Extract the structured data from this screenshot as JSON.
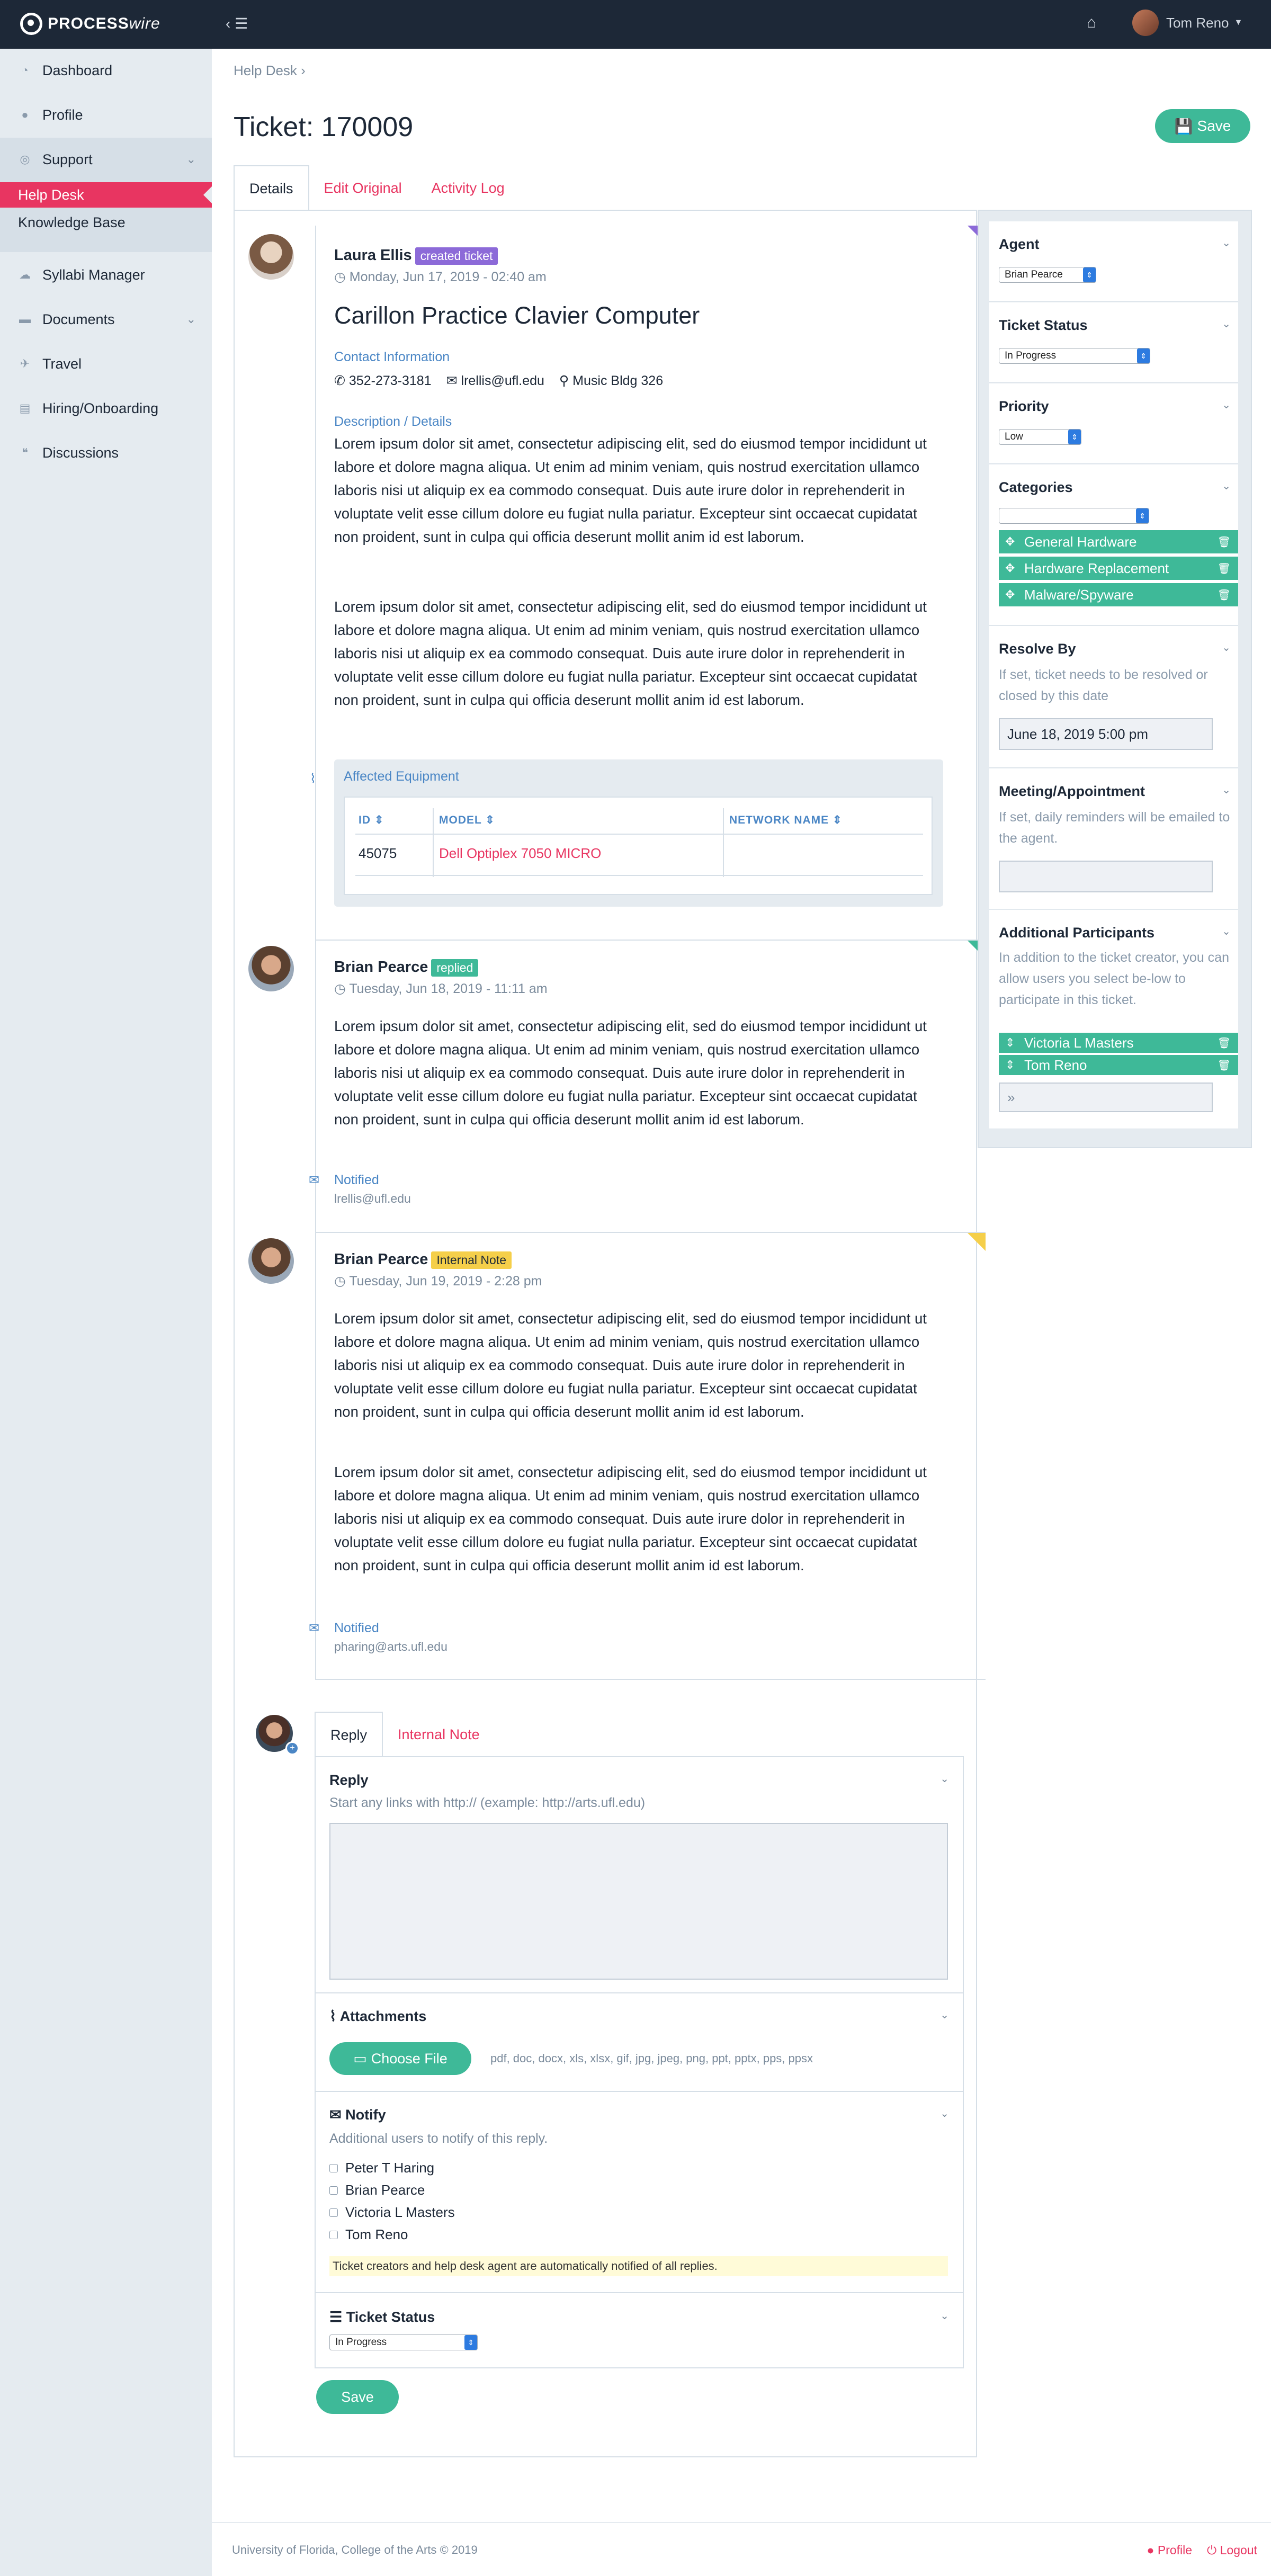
{
  "app": {
    "logo_main": "PROCESS",
    "logo_italic": "wire",
    "user_name": "Tom Reno"
  },
  "colors": {
    "accent": "#e83561",
    "green": "#3eb998",
    "navy": "#1d2837",
    "purple": "#8c6ad8",
    "yellow": "#f5cf4a"
  },
  "sidebar": {
    "items": [
      {
        "label": "Dashboard",
        "icon": "dashboard-icon"
      },
      {
        "label": "Profile",
        "icon": "user-icon"
      },
      {
        "label": "Support",
        "icon": "life-ring-icon"
      },
      {
        "label": "Syllabi Manager",
        "icon": "cloud-icon"
      },
      {
        "label": "Documents",
        "icon": "folder-icon"
      },
      {
        "label": "Travel",
        "icon": "plane-icon"
      },
      {
        "label": "Hiring/Onboarding",
        "icon": "book-icon"
      },
      {
        "label": "Discussions",
        "icon": "comments-icon"
      }
    ],
    "sub": [
      "Help Desk",
      "Knowledge Base"
    ]
  },
  "breadcrumb": "Help Desk",
  "page": {
    "title": "Ticket: 170009",
    "save": "Save"
  },
  "tabs": [
    "Details",
    "Edit Original",
    "Activity Log"
  ],
  "ticket": {
    "author": "Laura Ellis",
    "badge": "created ticket",
    "date": "Monday, Jun 17, 2019 - 02:40 am",
    "subject": "Carillon Practice Clavier Computer",
    "contact_label": "Contact Information",
    "phone": "352-273-3181",
    "email": "lrellis@ufl.edu",
    "location": "Music Bldg 326",
    "desc_label": "Description / Details",
    "p1": "Lorem ipsum dolor sit amet, consectetur adipiscing elit, sed do eiusmod tempor incididunt ut labore et dolore magna aliqua. Ut enim ad minim veniam, quis nostrud exercitation ullamco laboris nisi ut aliquip ex ea commodo consequat. Duis aute irure dolor in reprehenderit in voluptate velit esse cillum dolore eu fugiat nulla pariatur. Excepteur sint occaecat cupidatat non proident, sunt in culpa qui officia deserunt mollit anim id est laborum.",
    "p2": "Lorem ipsum dolor sit amet, consectetur adipiscing elit, sed do eiusmod tempor incididunt ut labore et dolore magna aliqua. Ut enim ad minim veniam, quis nostrud exercitation ullamco laboris nisi ut aliquip ex ea commodo consequat. Duis aute irure dolor in reprehenderit in voluptate velit esse cillum dolore eu fugiat nulla pariatur. Excepteur sint occaecat cupidatat non proident, sunt in culpa qui officia deserunt mollit anim id est laborum.",
    "equip_label": "Affected Equipment",
    "equip_headers": [
      "ID",
      "MODEL",
      "NETWORK NAME"
    ],
    "equip_row": {
      "id": "45075",
      "model": "Dell Optiplex 7050 MICRO",
      "network": ""
    }
  },
  "reply1": {
    "author": "Brian Pearce",
    "badge": "replied",
    "date": "Tuesday, Jun 18, 2019 - 11:11 am",
    "p1": "Lorem ipsum dolor sit amet, consectetur adipiscing elit, sed do eiusmod tempor incididunt ut labore et dolore magna aliqua. Ut enim ad minim veniam, quis nostrud exercitation ullamco laboris nisi ut aliquip ex ea commodo consequat. Duis aute irure dolor in reprehenderit in voluptate velit esse cillum dolore eu fugiat nulla pariatur. Excepteur sint occaecat cupidatat non proident, sunt in culpa qui officia deserunt mollit anim id est laborum.",
    "notified_label": "Notified",
    "notified": "lrellis@ufl.edu"
  },
  "reply2": {
    "author": "Brian Pearce",
    "badge": "Internal Note",
    "date": "Tuesday, Jun 19, 2019 - 2:28 pm",
    "p1": "Lorem ipsum dolor sit amet, consectetur adipiscing elit, sed do eiusmod tempor incididunt ut labore et dolore magna aliqua. Ut enim ad minim veniam, quis nostrud exercitation ullamco laboris nisi ut aliquip ex ea commodo consequat. Duis aute irure dolor in reprehenderit in voluptate velit esse cillum dolore eu fugiat nulla pariatur. Excepteur sint occaecat cupidatat non proident, sunt in culpa qui officia deserunt mollit anim id est laborum.",
    "p2": "Lorem ipsum dolor sit amet, consectetur adipiscing elit, sed do eiusmod tempor incididunt ut labore et dolore magna aliqua. Ut enim ad minim veniam, quis nostrud exercitation ullamco laboris nisi ut aliquip ex ea commodo consequat. Duis aute irure dolor in reprehenderit in voluptate velit esse cillum dolore eu fugiat nulla pariatur. Excepteur sint occaecat cupidatat non proident, sunt in culpa qui officia deserunt mollit anim id est laborum.",
    "notified_label": "Notified",
    "notified": "pharing@arts.ufl.edu"
  },
  "reply_form": {
    "tabs": [
      "Reply",
      "Internal Note"
    ],
    "reply_label": "Reply",
    "reply_hint": "Start any links with http:// (example: http://arts.ufl.edu)",
    "attach_label": "Attachments",
    "choose": "Choose File",
    "types": "pdf, doc, docx, xls, xlsx, gif, jpg, jpeg, png, ppt, pptx, pps, ppsx",
    "notify_label": "Notify",
    "notify_hint": "Additional users to notify of this reply.",
    "users": [
      "Peter T Haring",
      "Brian Pearce",
      "Victoria L Masters",
      "Tom Reno"
    ],
    "notice": "Ticket creators and help desk agent are automatically notified of all replies.",
    "status_label": "Ticket Status",
    "status": "In Progress",
    "save": "Save"
  },
  "right": {
    "agent_label": "Agent",
    "agent": "Brian Pearce",
    "status_label": "Ticket Status",
    "status": "In Progress",
    "priority_label": "Priority",
    "priority": "Low",
    "categories_label": "Categories",
    "categories": [
      "General Hardware",
      "Hardware Replacement",
      "Malware/Spyware"
    ],
    "resolve_label": "Resolve By",
    "resolve_hint": "If set, ticket needs to be resolved or closed by this date",
    "resolve_value": "June 18, 2019 5:00 pm",
    "meeting_label": "Meeting/Appointment",
    "meeting_hint": "If set, daily reminders will be emailed to the agent.",
    "participants_label": "Additional Participants",
    "participants_hint": "In addition to the ticket creator, you can allow users you select be-low to participate in this ticket.",
    "participants": [
      "Victoria L Masters",
      "Tom Reno"
    ],
    "participants_input": "»"
  },
  "footer": {
    "copyright": "University of Florida, College of the Arts © 2019",
    "profile": "Profile",
    "logout": "Logout"
  }
}
